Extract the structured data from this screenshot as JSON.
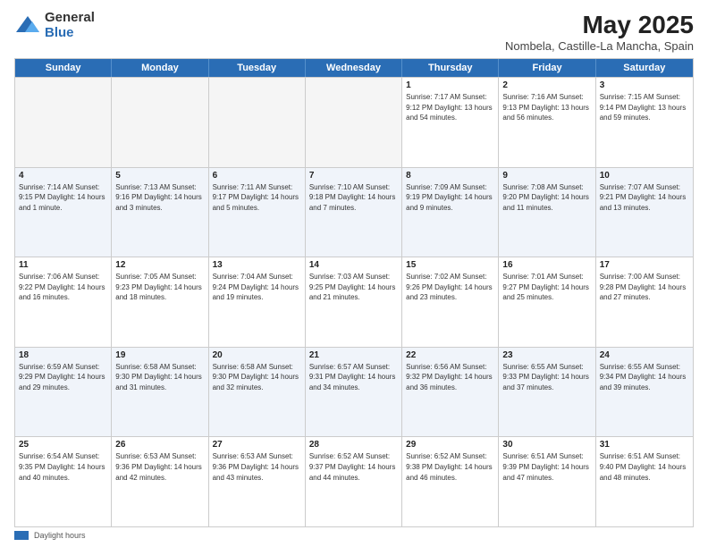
{
  "logo": {
    "general": "General",
    "blue": "Blue"
  },
  "title": "May 2025",
  "subtitle": "Nombela, Castille-La Mancha, Spain",
  "days_of_week": [
    "Sunday",
    "Monday",
    "Tuesday",
    "Wednesday",
    "Thursday",
    "Friday",
    "Saturday"
  ],
  "footer_label": "Daylight hours",
  "weeks": [
    {
      "cells": [
        {
          "empty": true
        },
        {
          "empty": true
        },
        {
          "empty": true
        },
        {
          "empty": true
        },
        {
          "day": "1",
          "info": "Sunrise: 7:17 AM\nSunset: 9:12 PM\nDaylight: 13 hours\nand 54 minutes."
        },
        {
          "day": "2",
          "info": "Sunrise: 7:16 AM\nSunset: 9:13 PM\nDaylight: 13 hours\nand 56 minutes."
        },
        {
          "day": "3",
          "info": "Sunrise: 7:15 AM\nSunset: 9:14 PM\nDaylight: 13 hours\nand 59 minutes."
        }
      ]
    },
    {
      "alt": true,
      "cells": [
        {
          "day": "4",
          "info": "Sunrise: 7:14 AM\nSunset: 9:15 PM\nDaylight: 14 hours\nand 1 minute."
        },
        {
          "day": "5",
          "info": "Sunrise: 7:13 AM\nSunset: 9:16 PM\nDaylight: 14 hours\nand 3 minutes."
        },
        {
          "day": "6",
          "info": "Sunrise: 7:11 AM\nSunset: 9:17 PM\nDaylight: 14 hours\nand 5 minutes."
        },
        {
          "day": "7",
          "info": "Sunrise: 7:10 AM\nSunset: 9:18 PM\nDaylight: 14 hours\nand 7 minutes."
        },
        {
          "day": "8",
          "info": "Sunrise: 7:09 AM\nSunset: 9:19 PM\nDaylight: 14 hours\nand 9 minutes."
        },
        {
          "day": "9",
          "info": "Sunrise: 7:08 AM\nSunset: 9:20 PM\nDaylight: 14 hours\nand 11 minutes."
        },
        {
          "day": "10",
          "info": "Sunrise: 7:07 AM\nSunset: 9:21 PM\nDaylight: 14 hours\nand 13 minutes."
        }
      ]
    },
    {
      "cells": [
        {
          "day": "11",
          "info": "Sunrise: 7:06 AM\nSunset: 9:22 PM\nDaylight: 14 hours\nand 16 minutes."
        },
        {
          "day": "12",
          "info": "Sunrise: 7:05 AM\nSunset: 9:23 PM\nDaylight: 14 hours\nand 18 minutes."
        },
        {
          "day": "13",
          "info": "Sunrise: 7:04 AM\nSunset: 9:24 PM\nDaylight: 14 hours\nand 19 minutes."
        },
        {
          "day": "14",
          "info": "Sunrise: 7:03 AM\nSunset: 9:25 PM\nDaylight: 14 hours\nand 21 minutes."
        },
        {
          "day": "15",
          "info": "Sunrise: 7:02 AM\nSunset: 9:26 PM\nDaylight: 14 hours\nand 23 minutes."
        },
        {
          "day": "16",
          "info": "Sunrise: 7:01 AM\nSunset: 9:27 PM\nDaylight: 14 hours\nand 25 minutes."
        },
        {
          "day": "17",
          "info": "Sunrise: 7:00 AM\nSunset: 9:28 PM\nDaylight: 14 hours\nand 27 minutes."
        }
      ]
    },
    {
      "alt": true,
      "cells": [
        {
          "day": "18",
          "info": "Sunrise: 6:59 AM\nSunset: 9:29 PM\nDaylight: 14 hours\nand 29 minutes."
        },
        {
          "day": "19",
          "info": "Sunrise: 6:58 AM\nSunset: 9:30 PM\nDaylight: 14 hours\nand 31 minutes."
        },
        {
          "day": "20",
          "info": "Sunrise: 6:58 AM\nSunset: 9:30 PM\nDaylight: 14 hours\nand 32 minutes."
        },
        {
          "day": "21",
          "info": "Sunrise: 6:57 AM\nSunset: 9:31 PM\nDaylight: 14 hours\nand 34 minutes."
        },
        {
          "day": "22",
          "info": "Sunrise: 6:56 AM\nSunset: 9:32 PM\nDaylight: 14 hours\nand 36 minutes."
        },
        {
          "day": "23",
          "info": "Sunrise: 6:55 AM\nSunset: 9:33 PM\nDaylight: 14 hours\nand 37 minutes."
        },
        {
          "day": "24",
          "info": "Sunrise: 6:55 AM\nSunset: 9:34 PM\nDaylight: 14 hours\nand 39 minutes."
        }
      ]
    },
    {
      "cells": [
        {
          "day": "25",
          "info": "Sunrise: 6:54 AM\nSunset: 9:35 PM\nDaylight: 14 hours\nand 40 minutes."
        },
        {
          "day": "26",
          "info": "Sunrise: 6:53 AM\nSunset: 9:36 PM\nDaylight: 14 hours\nand 42 minutes."
        },
        {
          "day": "27",
          "info": "Sunrise: 6:53 AM\nSunset: 9:36 PM\nDaylight: 14 hours\nand 43 minutes."
        },
        {
          "day": "28",
          "info": "Sunrise: 6:52 AM\nSunset: 9:37 PM\nDaylight: 14 hours\nand 44 minutes."
        },
        {
          "day": "29",
          "info": "Sunrise: 6:52 AM\nSunset: 9:38 PM\nDaylight: 14 hours\nand 46 minutes."
        },
        {
          "day": "30",
          "info": "Sunrise: 6:51 AM\nSunset: 9:39 PM\nDaylight: 14 hours\nand 47 minutes."
        },
        {
          "day": "31",
          "info": "Sunrise: 6:51 AM\nSunset: 9:40 PM\nDaylight: 14 hours\nand 48 minutes."
        }
      ]
    }
  ]
}
